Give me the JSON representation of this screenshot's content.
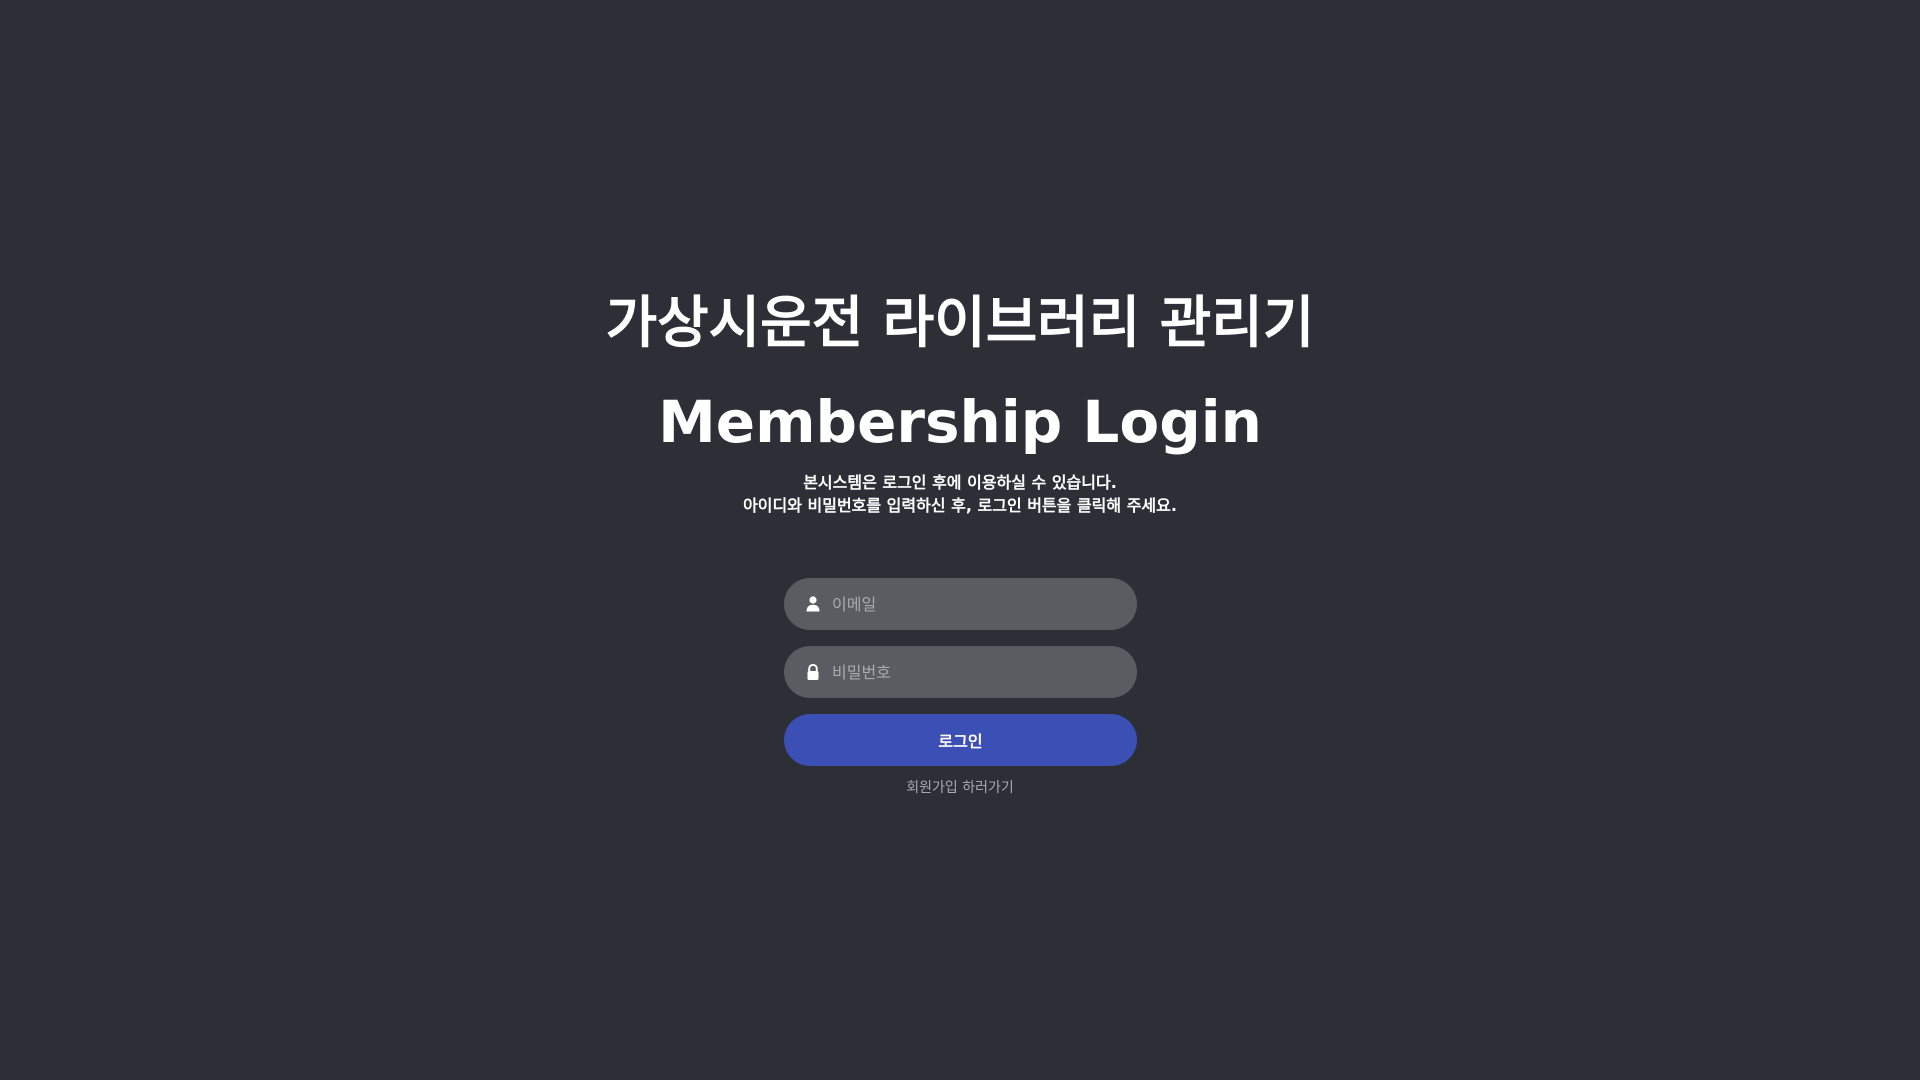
{
  "header": {
    "app_title": "가상시운전 라이브러리 관리기",
    "login_title": "Membership Login",
    "description_line1": "본시스템은 로그인 후에 이용하실 수 있습니다.",
    "description_line2": "아이디와 비밀번호를 입력하신 후, 로그인 버튼을 클릭해 주세요."
  },
  "form": {
    "email": {
      "icon": "user-icon",
      "placeholder": "이메일",
      "value": ""
    },
    "password": {
      "icon": "lock-icon",
      "placeholder": "비밀번호",
      "value": ""
    },
    "login_label": "로그인",
    "signup_label": "회원가입 하러가기"
  },
  "colors": {
    "background": "#2d2e36",
    "input_background": "#5b5c62",
    "accent": "#3b4fb4"
  }
}
